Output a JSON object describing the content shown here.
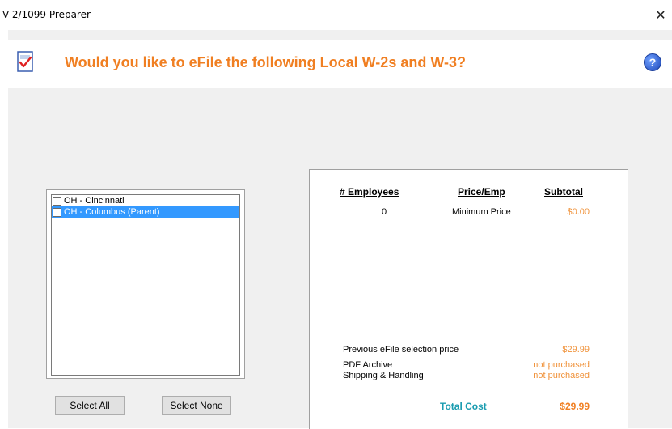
{
  "window": {
    "title": "V-2/1099 Preparer",
    "close_glyph": "✕"
  },
  "header": {
    "headline": "Would you like to eFile the following Local W-2s and W-3?",
    "help_glyph": "?",
    "icons": [
      "document-check-icon",
      "help-icon"
    ]
  },
  "locals_list": {
    "items": [
      {
        "label": "OH - Cincinnati",
        "checked": false,
        "selected": false
      },
      {
        "label": "OH - Columbus (Parent)",
        "checked": false,
        "selected": true
      }
    ]
  },
  "buttons": {
    "select_all": "Select All",
    "select_none": "Select None"
  },
  "pricing": {
    "headers": {
      "employees": "# Employees",
      "price_per_emp": "Price/Emp",
      "subtotal": "Subtotal"
    },
    "row": {
      "employees": "0",
      "price_per_emp": "Minimum Price",
      "subtotal": "$0.00"
    },
    "summary": [
      {
        "label": "Previous eFile selection price",
        "value": "$29.99"
      },
      {
        "label": "PDF Archive",
        "value": "not purchased"
      },
      {
        "label": "Shipping & Handling",
        "value": "not purchased"
      }
    ],
    "total_label": "Total Cost",
    "total_value": "$29.99"
  },
  "colors": {
    "accent_orange": "#f07f22",
    "total_teal": "#1a9cb0",
    "selection_blue": "#3399ff"
  }
}
